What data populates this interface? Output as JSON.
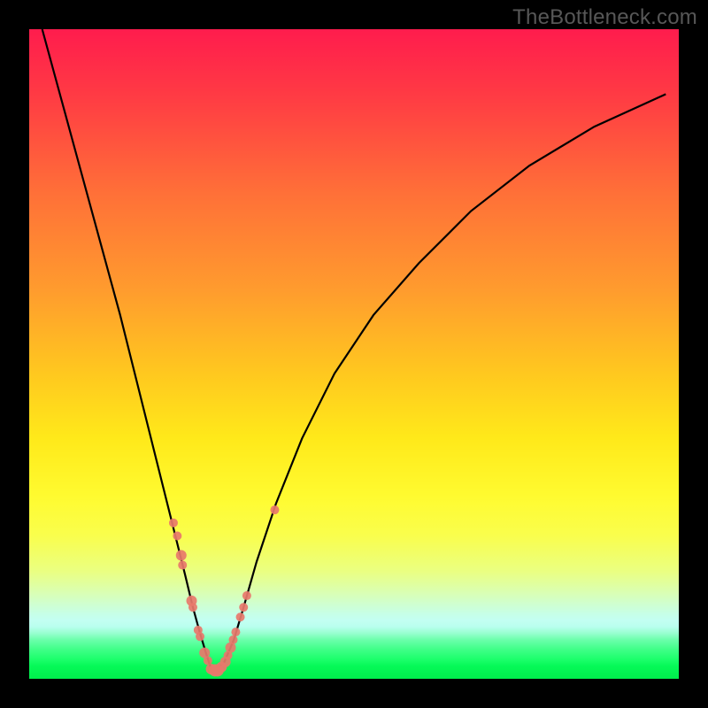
{
  "watermark": "TheBottleneck.com",
  "chart_data": {
    "type": "line",
    "title": "",
    "xlabel": "",
    "ylabel": "",
    "xlim": [
      0,
      100
    ],
    "ylim": [
      0,
      100
    ],
    "curve": {
      "name": "bottleneck-curve",
      "x": [
        2,
        5,
        8,
        11,
        14,
        17,
        19,
        21,
        22.5,
        24,
        25.2,
        26.3,
        27.2,
        28,
        28.8,
        30,
        31.5,
        33,
        35,
        38,
        42,
        47,
        53,
        60,
        68,
        77,
        87,
        98
      ],
      "y": [
        100,
        89,
        78,
        67,
        56,
        44,
        36,
        28,
        22,
        16,
        11,
        7,
        4,
        1.5,
        1.3,
        2.5,
        6,
        11,
        18,
        27,
        37,
        47,
        56,
        64,
        72,
        79,
        85,
        90
      ]
    },
    "points": {
      "name": "sample-dots",
      "x": [
        22.2,
        22.8,
        23.4,
        23.6,
        25.0,
        25.2,
        26.0,
        26.3,
        27.0,
        27.5,
        28.0,
        28.6,
        29.0,
        29.6,
        30.2,
        30.6,
        31.0,
        31.4,
        31.8,
        32.5,
        33.0,
        33.5,
        37.8
      ],
      "y": [
        24.0,
        22.0,
        19.0,
        17.5,
        12.0,
        11.0,
        7.5,
        6.5,
        4.0,
        2.8,
        1.5,
        1.3,
        1.3,
        1.8,
        2.6,
        3.6,
        4.8,
        6.0,
        7.2,
        9.5,
        11.0,
        12.8,
        26.0
      ],
      "r": [
        5,
        5,
        6,
        5,
        6,
        5,
        5,
        5,
        6,
        5,
        6,
        7,
        7,
        6,
        6,
        5,
        6,
        5,
        5,
        5,
        5,
        5,
        5
      ]
    },
    "gradient_stops": [
      {
        "pos": 0.0,
        "color": "#ff1c4d"
      },
      {
        "pos": 0.4,
        "color": "#ff9b2e"
      },
      {
        "pos": 0.7,
        "color": "#fffb30"
      },
      {
        "pos": 0.9,
        "color": "#c7ffe7"
      },
      {
        "pos": 1.0,
        "color": "#00ef4c"
      }
    ]
  }
}
